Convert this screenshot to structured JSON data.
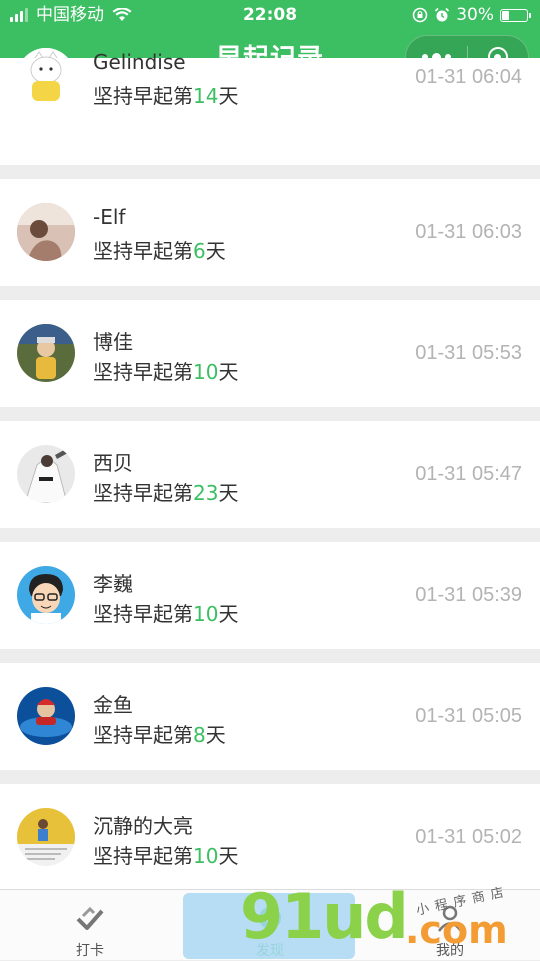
{
  "status_bar": {
    "carrier": "中国移动",
    "time": "22:08",
    "battery": "30%",
    "battery_level": 0.3
  },
  "nav": {
    "title": "早起记录"
  },
  "records": [
    {
      "name": "Gelindise",
      "prefix": "坚持早起第",
      "days": "14",
      "suffix": "天",
      "time": "01-31 06:04"
    },
    {
      "name": "-Elf",
      "prefix": "坚持早起第",
      "days": "6",
      "suffix": "天",
      "time": "01-31 06:03"
    },
    {
      "name": "博佳",
      "prefix": "坚持早起第",
      "days": "10",
      "suffix": "天",
      "time": "01-31 05:53"
    },
    {
      "name": "西贝",
      "prefix": "坚持早起第",
      "days": "23",
      "suffix": "天",
      "time": "01-31 05:47"
    },
    {
      "name": "李巍",
      "prefix": "坚持早起第",
      "days": "10",
      "suffix": "天",
      "time": "01-31 05:39"
    },
    {
      "name": "金鱼",
      "prefix": "坚持早起第",
      "days": "8",
      "suffix": "天",
      "time": "01-31 05:05"
    },
    {
      "name": "沉静的大亮",
      "prefix": "坚持早起第",
      "days": "10",
      "suffix": "天",
      "time": "01-31 05:02"
    }
  ],
  "tabs": [
    {
      "label": "打卡",
      "icon": "checkin-icon"
    },
    {
      "label": "发现",
      "icon": "discover-icon"
    },
    {
      "label": "我的",
      "icon": "profile-icon"
    }
  ],
  "watermark": {
    "main": "91ud",
    "suffix": ".com",
    "small": "小程序商店"
  },
  "colors": {
    "brand_green": "#3cbe62",
    "time_gray": "#b3b3b3"
  }
}
